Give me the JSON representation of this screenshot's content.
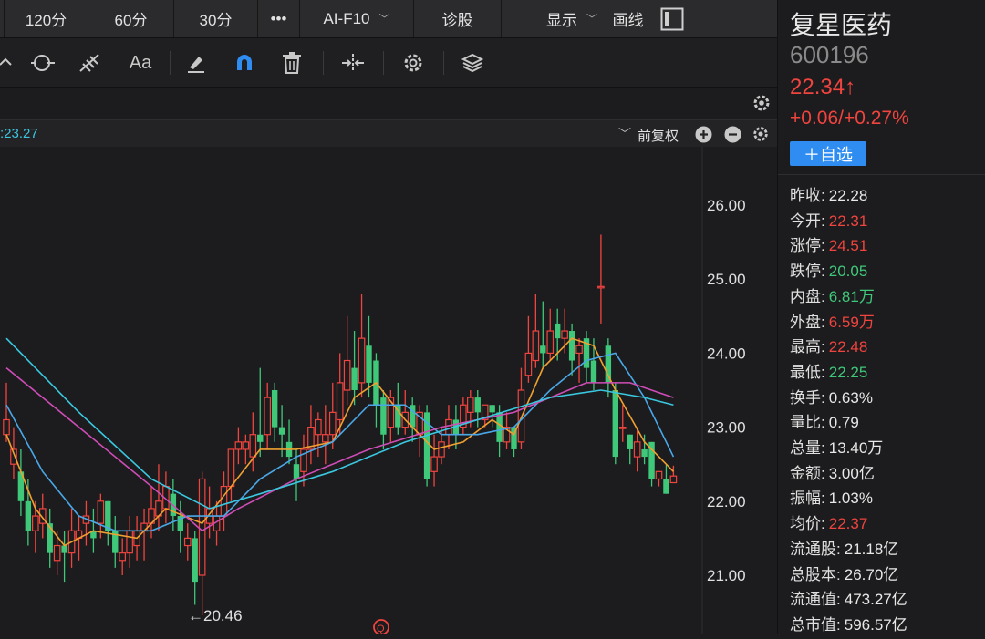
{
  "toolbar_tabs": {
    "t120": "120分",
    "t60": "60分",
    "t30": "30分",
    "more": "•••",
    "aif10": "AI-F10",
    "diagnose": "诊股",
    "display": "显示",
    "draw": "画线"
  },
  "tools": {
    "text_tool": "Aa",
    "ma_values": ":23.27",
    "adjust_mode": "前复权"
  },
  "stock": {
    "name": "复星医药",
    "code": "600196",
    "price": "22.34",
    "arrow": "↑",
    "change": "+0.06/+0.27%",
    "watch_button": "＋自选"
  },
  "stats": [
    {
      "label": "昨收:",
      "value": "22.28",
      "color": "white"
    },
    {
      "label": "今开:",
      "value": "22.31",
      "color": "red"
    },
    {
      "label": "涨停:",
      "value": "24.51",
      "color": "red"
    },
    {
      "label": "跌停:",
      "value": "20.05",
      "color": "green"
    },
    {
      "label": "内盘:",
      "value": "6.81万",
      "color": "green"
    },
    {
      "label": "外盘:",
      "value": "6.59万",
      "color": "red"
    },
    {
      "label": "最高:",
      "value": "22.48",
      "color": "red"
    },
    {
      "label": "最低:",
      "value": "22.25",
      "color": "green"
    },
    {
      "label": "换手:",
      "value": "0.63%",
      "color": "white"
    },
    {
      "label": "量比:",
      "value": "0.79",
      "color": "white"
    },
    {
      "label": "总量:",
      "value": "13.40万",
      "color": "white"
    },
    {
      "label": "金额:",
      "value": "3.00亿",
      "color": "white"
    },
    {
      "label": "振幅:",
      "value": "1.03%",
      "color": "white"
    },
    {
      "label": "均价:",
      "value": "22.37",
      "color": "red"
    },
    {
      "label": "流通股:",
      "value": "21.18亿",
      "color": "white"
    },
    {
      "label": "总股本:",
      "value": "26.70亿",
      "color": "white"
    },
    {
      "label": "流通值:",
      "value": "473.27亿",
      "color": "white"
    },
    {
      "label": "总市值:",
      "value": "596.57亿",
      "color": "white"
    }
  ],
  "colors": {
    "up": "#f0443f",
    "down": "#3fc87a",
    "accent": "#2f8cf0",
    "ma5": "#f0a030",
    "ma10": "#4aa8e8",
    "ma20": "#d04db8",
    "ma30": "#3ac8e0"
  },
  "chart_data": {
    "type": "candlestick",
    "y_ticks": [
      "26.00",
      "25.00",
      "24.00",
      "23.00",
      "22.00",
      "21.00"
    ],
    "ylim": [
      20.35,
      26.5
    ],
    "low_marker": "←20.46",
    "candles": [
      [
        22.9,
        23.6,
        23.1,
        22.8
      ],
      [
        22.5,
        23.0,
        22.7,
        22.3
      ],
      [
        22.4,
        22.7,
        22.0,
        21.8
      ],
      [
        22.0,
        22.3,
        21.6,
        21.4
      ],
      [
        21.6,
        22.0,
        21.8,
        21.3
      ],
      [
        21.7,
        22.1,
        21.9,
        21.5
      ],
      [
        21.7,
        21.9,
        21.3,
        21.1
      ],
      [
        21.2,
        21.6,
        21.4,
        21.0
      ],
      [
        21.4,
        21.6,
        21.3,
        20.9
      ],
      [
        21.3,
        21.9,
        21.6,
        21.1
      ],
      [
        21.5,
        21.8,
        21.6,
        21.2
      ],
      [
        21.7,
        22.0,
        21.8,
        21.4
      ],
      [
        21.6,
        21.9,
        21.5,
        21.3
      ],
      [
        21.7,
        22.1,
        22.0,
        21.5
      ],
      [
        22.0,
        22.0,
        21.6,
        21.4
      ],
      [
        21.6,
        21.8,
        21.3,
        21.1
      ],
      [
        21.2,
        21.5,
        21.3,
        21.0
      ],
      [
        21.3,
        21.8,
        21.6,
        21.1
      ],
      [
        21.4,
        21.8,
        21.6,
        21.2
      ],
      [
        21.6,
        21.9,
        21.7,
        21.2
      ],
      [
        21.7,
        22.2,
        21.9,
        21.5
      ],
      [
        21.8,
        22.5,
        22.0,
        21.6
      ],
      [
        21.9,
        22.4,
        22.2,
        21.7
      ],
      [
        22.1,
        22.3,
        21.8,
        21.6
      ],
      [
        21.8,
        22.0,
        21.6,
        21.3
      ],
      [
        21.4,
        21.7,
        21.5,
        21.2
      ],
      [
        21.5,
        21.6,
        20.9,
        20.6
      ],
      [
        21.0,
        22.4,
        22.3,
        20.46
      ],
      [
        21.7,
        22.2,
        21.9,
        21.5
      ],
      [
        21.6,
        22.0,
        21.8,
        21.4
      ],
      [
        21.8,
        22.4,
        22.2,
        21.6
      ],
      [
        22.2,
        22.7,
        22.7,
        22.0
      ],
      [
        22.7,
        23.0,
        22.8,
        22.5
      ],
      [
        22.7,
        22.9,
        22.8,
        22.5
      ],
      [
        22.6,
        23.2,
        22.9,
        22.4
      ],
      [
        22.9,
        23.8,
        22.8,
        22.6
      ],
      [
        22.9,
        23.6,
        23.4,
        22.7
      ],
      [
        23.5,
        23.6,
        23.0,
        22.8
      ],
      [
        23.0,
        23.3,
        22.9,
        22.6
      ],
      [
        22.8,
        23.1,
        22.6,
        22.5
      ],
      [
        22.5,
        22.7,
        22.3,
        22.0
      ],
      [
        22.4,
        22.9,
        22.7,
        22.2
      ],
      [
        22.7,
        23.3,
        23.0,
        22.5
      ],
      [
        22.9,
        23.2,
        23.1,
        22.6
      ],
      [
        22.8,
        23.3,
        22.9,
        22.5
      ],
      [
        22.9,
        23.6,
        23.2,
        22.7
      ],
      [
        23.1,
        24.0,
        23.6,
        22.9
      ],
      [
        23.5,
        24.5,
        23.9,
        23.3
      ],
      [
        23.8,
        24.3,
        23.5,
        23.3
      ],
      [
        23.6,
        24.8,
        24.2,
        23.4
      ],
      [
        24.1,
        24.5,
        23.6,
        23.4
      ],
      [
        23.9,
        24.0,
        23.3,
        23.0
      ],
      [
        23.4,
        23.5,
        22.9,
        22.7
      ],
      [
        23.0,
        23.5,
        23.4,
        22.8
      ],
      [
        23.3,
        23.6,
        23.0,
        22.9
      ],
      [
        23.0,
        23.5,
        23.2,
        22.9
      ],
      [
        23.3,
        23.4,
        23.0,
        22.8
      ],
      [
        22.9,
        23.3,
        23.2,
        22.6
      ],
      [
        23.2,
        23.3,
        22.3,
        22.2
      ],
      [
        22.4,
        22.9,
        22.6,
        22.2
      ],
      [
        22.6,
        23.0,
        22.8,
        22.5
      ],
      [
        22.9,
        23.3,
        23.1,
        22.7
      ],
      [
        23.1,
        23.3,
        22.9,
        22.7
      ],
      [
        23.0,
        23.4,
        23.3,
        22.9
      ],
      [
        23.2,
        23.5,
        23.4,
        23.0
      ],
      [
        23.4,
        23.5,
        23.2,
        23.0
      ],
      [
        23.1,
        23.3,
        23.3,
        23.0
      ],
      [
        23.3,
        23.3,
        23.2,
        23.0
      ],
      [
        23.2,
        23.3,
        22.8,
        22.6
      ],
      [
        22.8,
        23.2,
        23.0,
        22.7
      ],
      [
        23.0,
        23.0,
        22.7,
        22.6
      ],
      [
        22.8,
        23.8,
        23.5,
        22.7
      ],
      [
        23.7,
        24.5,
        24.0,
        23.6
      ],
      [
        23.9,
        24.8,
        24.3,
        23.8
      ],
      [
        24.1,
        24.7,
        24.0,
        23.8
      ],
      [
        24.0,
        24.6,
        24.3,
        23.9
      ],
      [
        24.4,
        24.6,
        24.2,
        23.9
      ],
      [
        24.2,
        24.6,
        24.3,
        24.0
      ],
      [
        24.3,
        24.4,
        23.9,
        23.7
      ],
      [
        24.0,
        24.2,
        24.1,
        23.6
      ],
      [
        24.2,
        24.3,
        23.8,
        23.6
      ],
      [
        23.9,
        24.2,
        23.6,
        23.5
      ],
      [
        24.9,
        25.6,
        24.9,
        24.4
      ],
      [
        24.1,
        24.2,
        23.6,
        23.4
      ],
      [
        23.5,
        23.6,
        22.6,
        22.5
      ],
      [
        23.0,
        23.3,
        23.0,
        22.8
      ],
      [
        22.9,
        22.9,
        22.7,
        22.5
      ],
      [
        22.6,
        23.0,
        22.8,
        22.4
      ],
      [
        22.7,
        22.9,
        22.6,
        22.5
      ],
      [
        22.8,
        22.8,
        22.3,
        22.2
      ],
      [
        22.3,
        22.4,
        22.4,
        22.2
      ],
      [
        22.3,
        22.5,
        22.1,
        22.1
      ],
      [
        22.25,
        22.48,
        22.34,
        22.25
      ]
    ],
    "ma": [
      {
        "name": "MA5",
        "color": "#f0a030",
        "points": [
          [
            0,
            22.9
          ],
          [
            4,
            21.9
          ],
          [
            8,
            21.4
          ],
          [
            12,
            21.6
          ],
          [
            18,
            21.5
          ],
          [
            22,
            21.9
          ],
          [
            27,
            21.7
          ],
          [
            31,
            22.2
          ],
          [
            35,
            22.7
          ],
          [
            40,
            22.7
          ],
          [
            45,
            22.8
          ],
          [
            48,
            23.4
          ],
          [
            51,
            23.6
          ],
          [
            55,
            23.1
          ],
          [
            59,
            22.7
          ],
          [
            63,
            22.8
          ],
          [
            67,
            23.1
          ],
          [
            70,
            22.9
          ],
          [
            74,
            23.8
          ],
          [
            78,
            24.2
          ],
          [
            81,
            24.1
          ],
          [
            84,
            23.5
          ],
          [
            88,
            22.8
          ],
          [
            92,
            22.4
          ]
        ]
      },
      {
        "name": "MA10",
        "color": "#4aa8e8",
        "points": [
          [
            0,
            23.3
          ],
          [
            5,
            22.4
          ],
          [
            10,
            21.8
          ],
          [
            15,
            21.6
          ],
          [
            20,
            21.6
          ],
          [
            25,
            21.8
          ],
          [
            30,
            21.8
          ],
          [
            35,
            22.3
          ],
          [
            40,
            22.6
          ],
          [
            45,
            22.8
          ],
          [
            50,
            23.3
          ],
          [
            55,
            23.3
          ],
          [
            60,
            22.9
          ],
          [
            65,
            22.9
          ],
          [
            70,
            23.0
          ],
          [
            75,
            23.5
          ],
          [
            80,
            23.9
          ],
          [
            84,
            24.0
          ],
          [
            88,
            23.4
          ],
          [
            92,
            22.6
          ]
        ]
      },
      {
        "name": "MA20",
        "color": "#d04db8",
        "points": [
          [
            0,
            23.8
          ],
          [
            10,
            23.0
          ],
          [
            20,
            22.2
          ],
          [
            27,
            21.6
          ],
          [
            32,
            21.9
          ],
          [
            40,
            22.3
          ],
          [
            50,
            22.7
          ],
          [
            60,
            23.0
          ],
          [
            70,
            23.2
          ],
          [
            80,
            23.6
          ],
          [
            86,
            23.6
          ],
          [
            92,
            23.4
          ]
        ]
      },
      {
        "name": "MA30",
        "color": "#3ac8e0",
        "points": [
          [
            0,
            24.2
          ],
          [
            10,
            23.2
          ],
          [
            20,
            22.3
          ],
          [
            28,
            21.9
          ],
          [
            35,
            22.1
          ],
          [
            45,
            22.4
          ],
          [
            55,
            22.8
          ],
          [
            65,
            23.1
          ],
          [
            75,
            23.4
          ],
          [
            82,
            23.5
          ],
          [
            88,
            23.4
          ],
          [
            92,
            23.3
          ]
        ]
      }
    ]
  }
}
